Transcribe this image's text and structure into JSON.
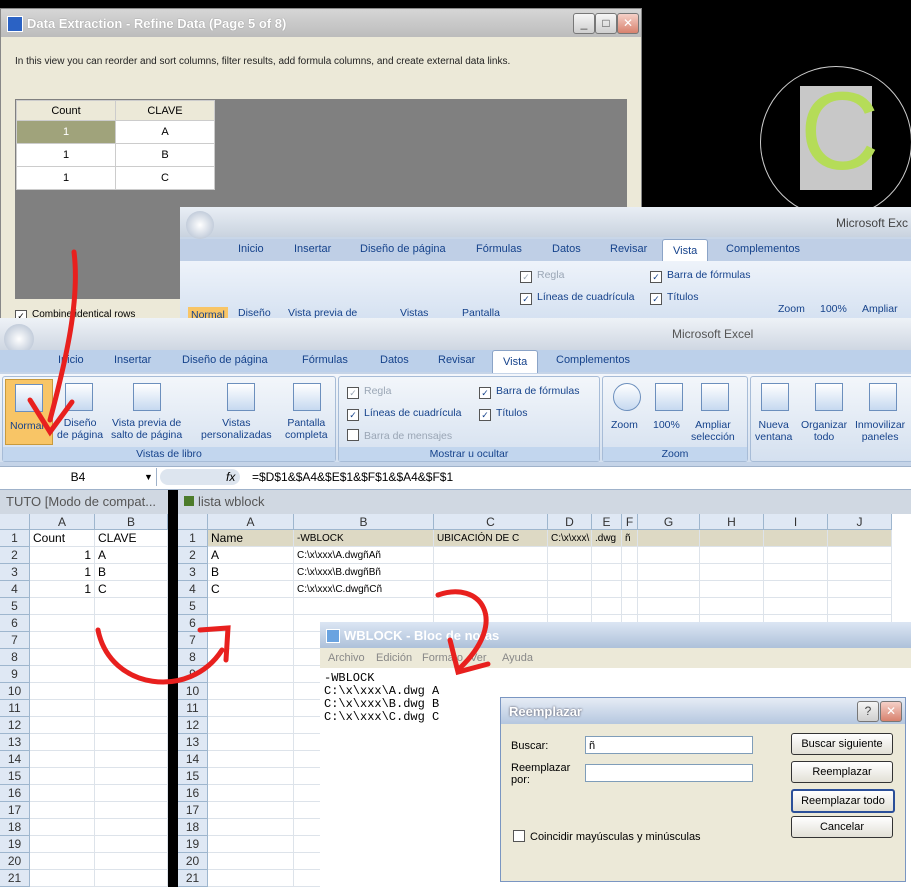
{
  "data_extraction": {
    "title": "Data Extraction - Refine Data (Page 5 of 8)",
    "description": "In this view you can reorder and sort columns, filter results, add formula columns, and create external data links.",
    "columns": [
      "Count",
      "CLAVE"
    ],
    "rows": [
      [
        "1",
        "A"
      ],
      [
        "1",
        "B"
      ],
      [
        "1",
        "C"
      ]
    ],
    "combine_label": "Combine identical rows"
  },
  "cad": {
    "letter": "C"
  },
  "excel_back": {
    "app_title": "Microsoft Exc",
    "tabs": [
      "Inicio",
      "Insertar",
      "Diseño de página",
      "Fórmulas",
      "Datos",
      "Revisar",
      "Vista",
      "Complementos"
    ],
    "buttons": [
      "Normal",
      "Diseño",
      "Vista previa de",
      "Vistas",
      "Pantalla"
    ],
    "checks": [
      "Regla",
      "Líneas de cuadrícula",
      "Barra de mensajes",
      "Barra de fórmulas",
      "Títulos"
    ],
    "zoom_buttons": [
      "Zoom",
      "100%",
      "Ampliar"
    ]
  },
  "excel_front": {
    "app_title": "Microsoft Excel",
    "tabs": [
      "Inicio",
      "Insertar",
      "Diseño de página",
      "Fórmulas",
      "Datos",
      "Revisar",
      "Vista",
      "Complementos"
    ],
    "active_tab": "Vista",
    "groups": {
      "vistas": {
        "label": "Vistas de libro",
        "normal": "Normal",
        "diseno1": "Diseño",
        "diseno2": "de página",
        "vp1": "Vista previa de",
        "vp2": "salto de página",
        "vistas1": "Vistas",
        "vistas2": "personalizadas",
        "pantalla1": "Pantalla",
        "pantalla2": "completa"
      },
      "mostrar": {
        "label": "Mostrar u ocultar",
        "regla": "Regla",
        "lineas": "Líneas de cuadrícula",
        "mensajes": "Barra de mensajes",
        "formulas": "Barra de fórmulas",
        "titulos": "Títulos"
      },
      "zoom": {
        "label": "Zoom",
        "zoom": "Zoom",
        "cien": "100%",
        "ampliar1": "Ampliar",
        "ampliar2": "selección"
      },
      "ventana": {
        "nueva1": "Nueva",
        "nueva2": "ventana",
        "org1": "Organizar",
        "org2": "todo",
        "inm1": "Inmovilizar",
        "inm2": "paneles"
      }
    },
    "name_box": "B4",
    "fx": "fx",
    "formula": "=$D$1&$A4&$E$1&$F$1&$A4&$F$1"
  },
  "sheet_left": {
    "title": "TUTO  [Modo de compat...",
    "cols": [
      "A",
      "B"
    ],
    "rows": [
      "1",
      "2",
      "3",
      "4",
      "5",
      "6",
      "7",
      "8",
      "9",
      "10",
      "11",
      "12",
      "13",
      "14",
      "15",
      "16",
      "17",
      "18",
      "19",
      "20",
      "21"
    ],
    "cells": [
      [
        "Count",
        "CLAVE"
      ],
      [
        "1",
        "A"
      ],
      [
        "1",
        "B"
      ],
      [
        "1",
        "C"
      ]
    ]
  },
  "sheet_right": {
    "title": "lista wblock",
    "cols": [
      "A",
      "B",
      "C",
      "D",
      "E",
      "F",
      "G",
      "H",
      "I",
      "J"
    ],
    "rows": [
      "1",
      "2",
      "3",
      "4",
      "5",
      "6",
      "7",
      "8",
      "9",
      "10",
      "11",
      "12",
      "13",
      "14",
      "15",
      "16",
      "17",
      "18",
      "19",
      "20",
      "21"
    ],
    "header_row": [
      "Name",
      "-WBLOCK",
      "UBICACIÓN DE C",
      "C:\\x\\xxx\\",
      ".dwg",
      "ñ"
    ],
    "data_rows": [
      [
        "A",
        "C:\\x\\xxx\\A.dwgñAñ"
      ],
      [
        "B",
        "C:\\x\\xxx\\B.dwgñBñ"
      ],
      [
        "C",
        "C:\\x\\xxx\\C.dwgñCñ"
      ]
    ]
  },
  "notepad": {
    "title": "WBLOCK - Bloc de notas",
    "menu": [
      "Archivo",
      "Edición",
      "Formato",
      "Ver",
      "Ayuda"
    ],
    "text": "-WBLOCK\nC:\\x\\xxx\\A.dwg A\nC:\\x\\xxx\\B.dwg B\nC:\\x\\xxx\\C.dwg C"
  },
  "reemplazar": {
    "title": "Reemplazar",
    "buscar_label": "Buscar:",
    "buscar_value": "ñ",
    "reemplazar_label1": "Reemplazar",
    "reemplazar_label2": "por:",
    "reemplazar_value": "",
    "btn_buscar": "Buscar siguiente",
    "btn_reemplazar": "Reemplazar",
    "btn_todo": "Reemplazar todo",
    "btn_cancelar": "Cancelar",
    "match_case": "Coincidir mayúsculas y minúsculas"
  },
  "colors": {
    "arrow": "#e8201e",
    "cad_letter": "#b5dc58",
    "accent": "#15428b"
  }
}
